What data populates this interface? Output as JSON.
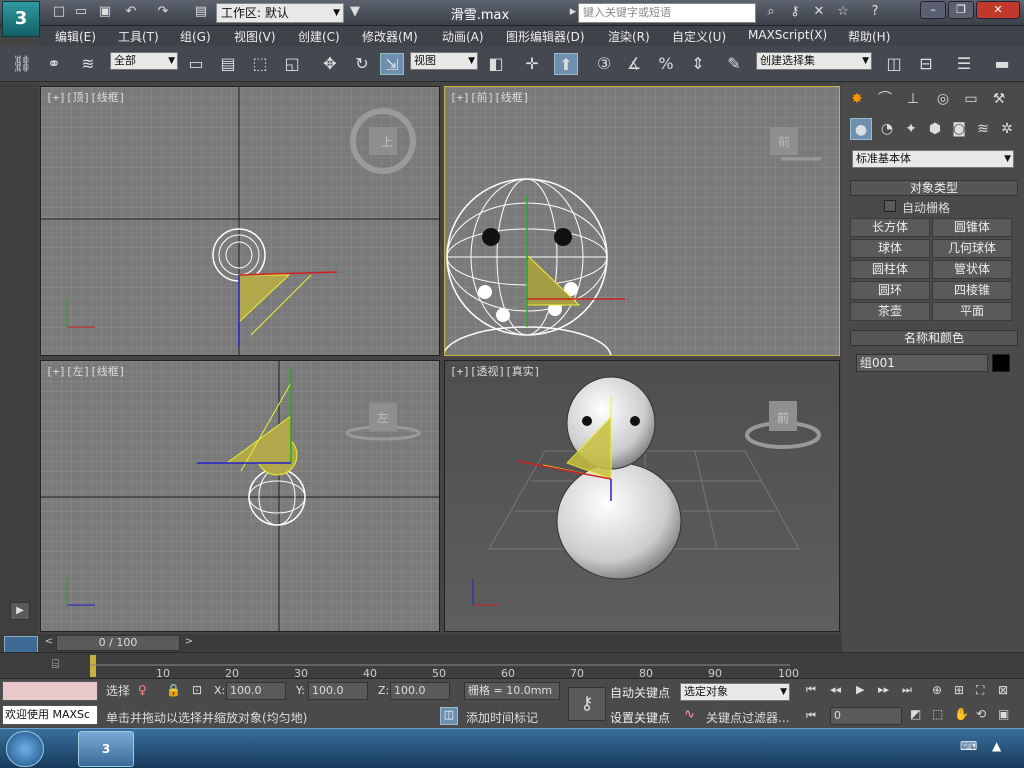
{
  "titlebar": {
    "workspace_label": "工作区: 默认",
    "filename": "滑雪.max",
    "search_placeholder": "键入关键字或短语",
    "logo": "3"
  },
  "menu": [
    "编辑(E)",
    "工具(T)",
    "组(G)",
    "视图(V)",
    "创建(C)",
    "修改器(M)",
    "动画(A)",
    "图形编辑器(D)",
    "渲染(R)",
    "自定义(U)",
    "MAXScript(X)",
    "帮助(H)"
  ],
  "toolbar": {
    "filter": "全部",
    "coord": "视图",
    "selection_set": "创建选择集"
  },
  "viewports": {
    "top": {
      "label": "[+][顶][线框]",
      "cube": "上"
    },
    "front": {
      "label": "[+][前][线框]",
      "cube": "前"
    },
    "left": {
      "label": "[+][左][线框]",
      "cube": "左"
    },
    "persp": {
      "label": "[+][透视][真实]",
      "cube": "前"
    }
  },
  "panel": {
    "category": "标准基本体",
    "object_type_title": "对象类型",
    "auto_grid": "自动栅格",
    "buttons": [
      "长方体",
      "圆锥体",
      "球体",
      "几何球体",
      "圆柱体",
      "管状体",
      "圆环",
      "四棱锥",
      "茶壶",
      "平面"
    ],
    "name_color_title": "名称和颜色",
    "object_name": "组001",
    "object_color": "#000000"
  },
  "timeline": {
    "frame": "0 / 100"
  },
  "trackbar": {
    "ticks": [
      "10",
      "20",
      "30",
      "40",
      "50",
      "60",
      "70",
      "80",
      "90",
      "100"
    ]
  },
  "status": {
    "welcome": "欢迎使用 MAXSc",
    "select_label": "选择",
    "x_label": "X:",
    "x_value": "100.0",
    "y_label": "Y:",
    "y_value": "100.0",
    "z_label": "Z:",
    "z_value": "100.0",
    "grid": "栅格 = 10.0mm",
    "prompt": "单击并拖动以选择并缩放对象(均匀地)",
    "add_time_tag": "添加时间标记",
    "auto_key": "自动关键点",
    "set_key": "设置关键点",
    "key_mode": "选定对象",
    "key_filters": "关键点过滤器...",
    "current_frame": "0"
  }
}
